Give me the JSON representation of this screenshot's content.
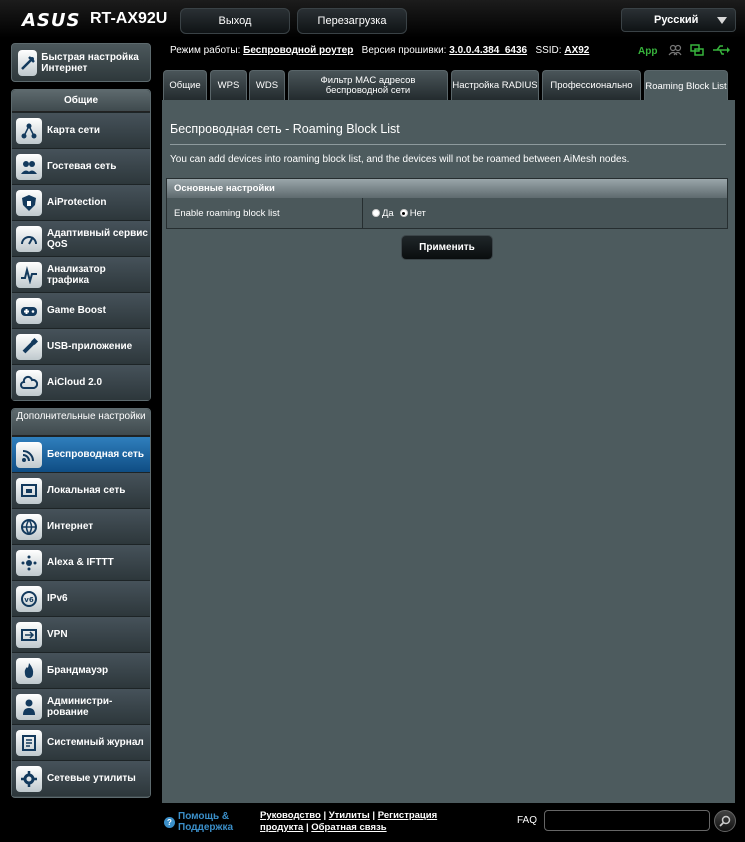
{
  "header": {
    "brand": "ASUS",
    "model": "RT-AX92U",
    "logout_label": "Выход",
    "reboot_label": "Перезагрузка",
    "language": "Русский"
  },
  "status": {
    "mode_label": "Режим работы:",
    "mode_value": "Беспроводной роутер",
    "firmware_label": "Версия прошивки:",
    "firmware_value": "3.0.0.4.384_6436",
    "ssid_label": "SSID:",
    "ssid_value": "AX92",
    "app_label": "App"
  },
  "sidebar": {
    "quick_setup": "Быстрая настройка Интернет",
    "general_header": "Общие",
    "general_items": [
      {
        "label": "Карта сети",
        "icon": "network-map-icon"
      },
      {
        "label": "Гостевая сеть",
        "icon": "guest-network-icon"
      },
      {
        "label": "AiProtection",
        "icon": "aiprotection-icon"
      },
      {
        "label": "Адаптивный сервис QoS",
        "icon": "qos-icon"
      },
      {
        "label": "Анализатор трафика",
        "icon": "traffic-analyzer-icon"
      },
      {
        "label": "Game Boost",
        "icon": "gamepad-icon"
      },
      {
        "label": "USB-приложение",
        "icon": "usb-icon"
      },
      {
        "label": "AiCloud 2.0",
        "icon": "cloud-icon"
      }
    ],
    "advanced_header": "Дополнительные настройки",
    "advanced_items": [
      {
        "label": "Беспроводная сеть",
        "icon": "wireless-icon"
      },
      {
        "label": "Локальная сеть",
        "icon": "lan-icon"
      },
      {
        "label": "Интернет",
        "icon": "globe-icon"
      },
      {
        "label": "Alexa & IFTTT",
        "icon": "alexa-icon"
      },
      {
        "label": "IPv6",
        "icon": "ipv6-icon"
      },
      {
        "label": "VPN",
        "icon": "vpn-icon"
      },
      {
        "label": "Брандмауэр",
        "icon": "firewall-icon"
      },
      {
        "label": "Администри-рование",
        "icon": "admin-icon"
      },
      {
        "label": "Системный журнал",
        "icon": "syslog-icon"
      },
      {
        "label": "Сетевые утилиты",
        "icon": "tools-icon"
      }
    ]
  },
  "tabs": [
    {
      "label": "Общие"
    },
    {
      "label": "WPS"
    },
    {
      "label": "WDS"
    },
    {
      "label": "Фильтр MAC адресов беспроводной сети"
    },
    {
      "label": "Настройка RADIUS"
    },
    {
      "label": "Профессионально"
    },
    {
      "label": "Roaming Block List"
    }
  ],
  "main": {
    "title": "Беспроводная сеть - Roaming Block List",
    "description": "You can add devices into roaming block list, and the devices will not be roamed between AiMesh nodes.",
    "section_header": "Основные настройки",
    "setting_label": "Enable roaming block list",
    "option_yes": "Да",
    "option_no": "Нет",
    "apply_label": "Применить"
  },
  "footer": {
    "help": "Помощь & Поддержка",
    "link_manual": "Руководство",
    "link_utilities": "Утилиты",
    "link_register": "Регистрация продукта",
    "link_feedback": "Обратная связь",
    "faq_label": "FAQ"
  },
  "colors": {
    "accent": "#0f4d84",
    "panel": "#4d5b5e",
    "help_blue": "#3b8fc9",
    "app_green": "#37b43c"
  }
}
